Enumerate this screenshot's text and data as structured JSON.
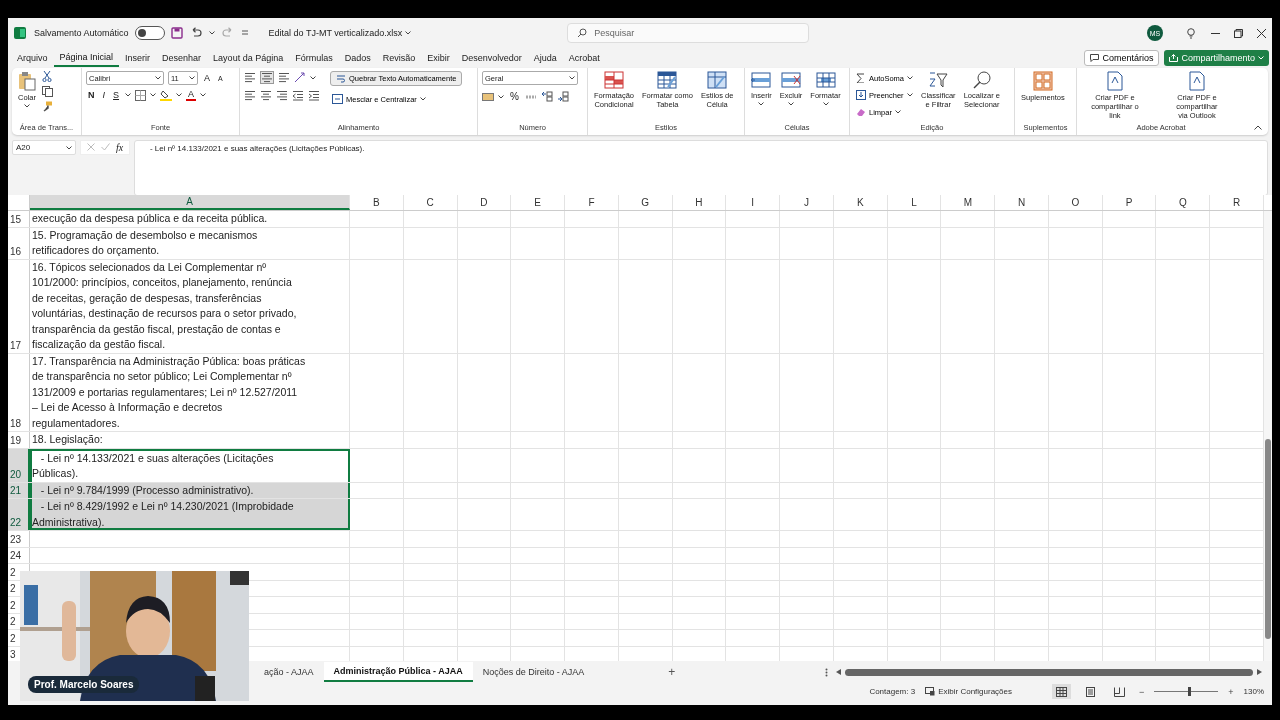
{
  "title_bar": {
    "autosave_label": "Salvamento Automático",
    "autosave_on": false,
    "file_name": "Edital do TJ-MT verticalizado.xlsx",
    "search_placeholder": "Pesquisar",
    "avatar": "MS"
  },
  "menu_tabs": [
    {
      "label": "Arquivo",
      "selected": false
    },
    {
      "label": "Página Inicial",
      "selected": true
    },
    {
      "label": "Inserir",
      "selected": false
    },
    {
      "label": "Desenhar",
      "selected": false
    },
    {
      "label": "Layout da Página",
      "selected": false
    },
    {
      "label": "Fórmulas",
      "selected": false
    },
    {
      "label": "Dados",
      "selected": false
    },
    {
      "label": "Revisão",
      "selected": false
    },
    {
      "label": "Exibir",
      "selected": false
    },
    {
      "label": "Desenvolvedor",
      "selected": false
    },
    {
      "label": "Ajuda",
      "selected": false
    },
    {
      "label": "Acrobat",
      "selected": false
    }
  ],
  "comments_button": "Comentários",
  "share_button": "Compartilhamento",
  "ribbon": {
    "clipboard": {
      "paste": "Colar",
      "label": "Área de Trans..."
    },
    "font": {
      "family": "Calibri",
      "size": "11",
      "grow": "A",
      "shrink": "A",
      "bold": "N",
      "italic": "I",
      "underline": "S",
      "font_color": "A",
      "label": "Fonte"
    },
    "alignment": {
      "wrap_text": {
        "label": "Quebrar Texto Automaticamente",
        "on": true
      },
      "merge": "Mesclar e Centralizar",
      "label": "Alinhamento"
    },
    "number": {
      "format": "Geral",
      "percent": "%",
      "label": "Número"
    },
    "styles": {
      "buttons": [
        [
          "Formatação",
          "Condicional"
        ],
        [
          "Formatar como",
          "Tabela"
        ],
        [
          "Estilos de",
          "Célula"
        ]
      ],
      "label": "Estilos"
    },
    "cells": {
      "buttons": [
        "Inserir",
        "Excluir",
        "Formatar"
      ],
      "label": "Células"
    },
    "editing": {
      "small": [
        "AutoSoma",
        "Preencher",
        "Limpar"
      ],
      "large": [
        [
          "Classificar",
          "e Filtrar"
        ],
        [
          "Localizar e",
          "Selecionar"
        ]
      ],
      "label": "Edição"
    },
    "addins": {
      "button": "Suplementos",
      "label": "Suplementos"
    },
    "acrobat": {
      "buttons": [
        [
          "Criar PDF e",
          "compartilhar o link"
        ],
        [
          "Criar PDF e compartilhar",
          "via Outlook"
        ]
      ],
      "label": "Adobe Acrobat"
    }
  },
  "formula_bar": {
    "name_box": "A20",
    "function_icon": "fx",
    "content": "   - Lei nº 14.133/2021 e suas alterações (Licitações Públicas)."
  },
  "columns": [
    {
      "label": "A",
      "selected": true
    },
    {
      "label": "B",
      "selected": false
    },
    {
      "label": "C",
      "selected": false
    },
    {
      "label": "D",
      "selected": false
    },
    {
      "label": "E",
      "selected": false
    },
    {
      "label": "F",
      "selected": false
    },
    {
      "label": "G",
      "selected": false
    },
    {
      "label": "H",
      "selected": false
    },
    {
      "label": "I",
      "selected": false
    },
    {
      "label": "J",
      "selected": false
    },
    {
      "label": "K",
      "selected": false
    },
    {
      "label": "L",
      "selected": false
    },
    {
      "label": "M",
      "selected": false
    },
    {
      "label": "N",
      "selected": false
    },
    {
      "label": "O",
      "selected": false
    },
    {
      "label": "P",
      "selected": false
    },
    {
      "label": "Q",
      "selected": false
    },
    {
      "label": "R",
      "selected": false
    }
  ],
  "rows": [
    {
      "number": "15",
      "lines": [
        "execução da despesa pública e da receita pública."
      ],
      "selected": false
    },
    {
      "number": "16",
      "lines": [
        "15. Programação de desembolso e mecanismos",
        "retificadores do orçamento."
      ],
      "selected": false
    },
    {
      "number": "17",
      "lines": [
        "16. Tópicos selecionados da Lei Complementar nº",
        "101/2000: princípios, conceitos, planejamento, renúncia",
        "de receitas, geração de despesas, transferências",
        "voluntárias, destinação de recursos para o setor privado,",
        "transparência da gestão fiscal, prestação de contas e",
        "fiscalização da gestão fiscal."
      ],
      "selected": false
    },
    {
      "number": "18",
      "lines": [
        "17. Transparência na Administração Pública: boas práticas",
        "de transparência no setor público; Lei Complementar nº",
        "131/2009 e portarias regulamentares; Lei nº 12.527/2011",
        "– Lei de Acesso à Informação e decretos",
        "regulamentadores."
      ],
      "selected": false
    },
    {
      "number": "19",
      "lines": [
        "18. Legislação:"
      ],
      "selected": false
    },
    {
      "number": "20",
      "lines": [
        "   - Lei nº 14.133/2021 e suas alterações (Licitações",
        "Públicas)."
      ],
      "selected": true
    },
    {
      "number": "21",
      "lines": [
        "   - Lei nº 9.784/1999 (Processo administrativo)."
      ],
      "selected": true
    },
    {
      "number": "22",
      "lines": [
        "   - Lei nº 8.429/1992 e Lei nº 14.230/2021 (Improbidade",
        "Administrativa)."
      ],
      "selected": true
    },
    {
      "number": "23",
      "lines": [],
      "selected": false
    },
    {
      "number": "24",
      "lines": [],
      "selected": false
    },
    {
      "number": "2",
      "lines": [],
      "selected": false
    },
    {
      "number": "2",
      "lines": [],
      "selected": false
    },
    {
      "number": "2",
      "lines": [],
      "selected": false
    },
    {
      "number": "2",
      "lines": [],
      "selected": false
    },
    {
      "number": "2",
      "lines": [],
      "selected": false
    },
    {
      "number": "3",
      "lines": [],
      "selected": false
    }
  ],
  "sheet_tabs": [
    {
      "label": "ação - AJAA",
      "selected": false
    },
    {
      "label": "Administração Pública - AJAA",
      "selected": true
    },
    {
      "label": "Noções de Direito - AJAA",
      "selected": false
    }
  ],
  "add_sheet": "+",
  "video_overlay": {
    "kind": "picture",
    "caption": "Prof. Marcelo Soares"
  },
  "status_bar": {
    "count": "Contagem: 3",
    "display_settings": "Exibir Configurações",
    "views": [
      {
        "selected": true
      },
      {
        "selected": false
      },
      {
        "selected": false
      }
    ],
    "zoom_minus": "−",
    "zoom_plus": "+",
    "zoom_slider": {
      "level": 0.55
    },
    "zoom": "130%"
  }
}
